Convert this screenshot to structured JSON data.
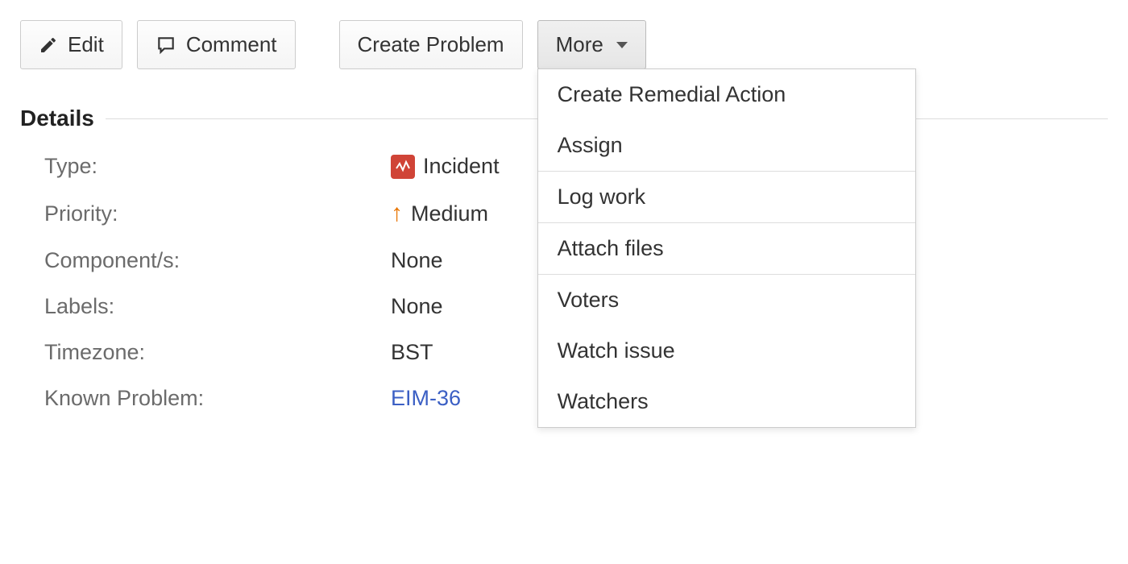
{
  "toolbar": {
    "edit_label": "Edit",
    "comment_label": "Comment",
    "create_problem_label": "Create Problem",
    "more_label": "More"
  },
  "more_menu": {
    "groups": [
      [
        "Create Remedial Action",
        "Assign"
      ],
      [
        "Log work"
      ],
      [
        "Attach files"
      ],
      [
        "Voters",
        "Watch issue",
        "Watchers"
      ]
    ]
  },
  "section": {
    "details_title": "Details"
  },
  "details": {
    "fields": [
      {
        "label": "Type:",
        "value": "Incident",
        "icon": "incident"
      },
      {
        "label": "Priority:",
        "value": "Medium",
        "icon": "priority-up"
      },
      {
        "label": "Component/s:",
        "value": "None"
      },
      {
        "label": "Labels:",
        "value": "None"
      },
      {
        "label": "Timezone:",
        "value": "BST"
      },
      {
        "label": "Known Problem:",
        "value": "EIM-36",
        "link": true
      }
    ]
  }
}
